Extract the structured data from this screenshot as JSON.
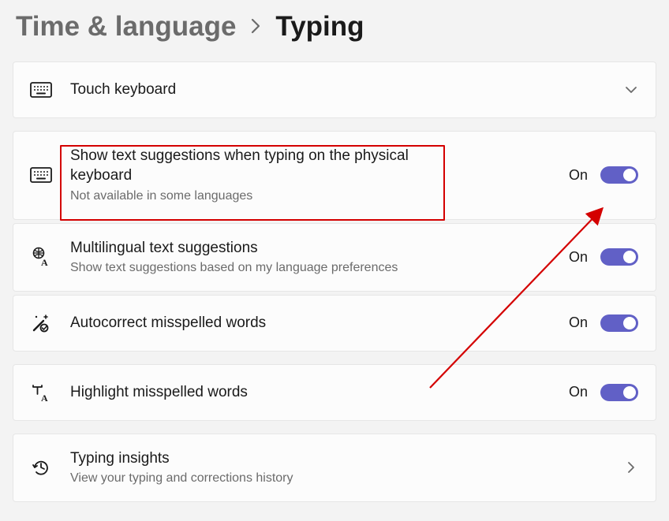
{
  "breadcrumb": {
    "parent": "Time & language",
    "current": "Typing"
  },
  "items": [
    {
      "title": "Touch keyboard"
    },
    {
      "title": "Show text suggestions when typing on the physical keyboard",
      "desc": "Not available in some languages",
      "state": "On"
    },
    {
      "title": "Multilingual text suggestions",
      "desc": "Show text suggestions based on my language preferences",
      "state": "On"
    },
    {
      "title": "Autocorrect misspelled words",
      "state": "On"
    },
    {
      "title": "Highlight misspelled words",
      "state": "On"
    },
    {
      "title": "Typing insights",
      "desc": "View your typing and corrections history"
    }
  ]
}
